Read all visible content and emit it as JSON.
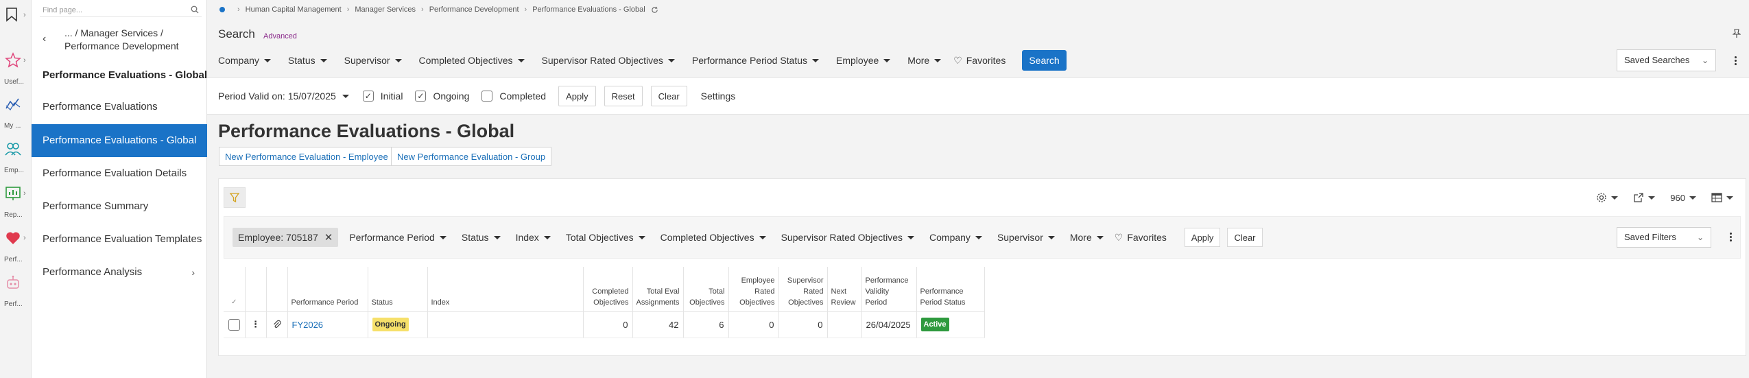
{
  "colors": {
    "accent": "#1a73c7",
    "nav_active_bg": "#1a73c7",
    "badge_ongoing": "#f6e06a",
    "badge_active": "#2e9a3e",
    "advanced_link": "#8a2a8a"
  },
  "rail": {
    "items": [
      {
        "icon": "bookmark-icon",
        "label": ""
      },
      {
        "icon": "star-icon",
        "label": "Usef..."
      },
      {
        "icon": "line-chart-icon",
        "label": "My ..."
      },
      {
        "icon": "people-icon",
        "label": "Emp..."
      },
      {
        "icon": "report-icon",
        "label": "Rep..."
      },
      {
        "icon": "heart-icon",
        "label": "Perf..."
      },
      {
        "icon": "robot-icon",
        "label": "Perf..."
      }
    ]
  },
  "nav": {
    "find_placeholder": "Find page...",
    "breadcrumb": "... / Manager Services / Performance Development",
    "current": "Performance Evaluations - Global",
    "items": [
      {
        "label": "Performance Evaluations"
      },
      {
        "label": "Performance Evaluations - Global"
      },
      {
        "label": "Performance Evaluation Details"
      },
      {
        "label": "Performance Summary"
      },
      {
        "label": "Performance Evaluation Templates"
      },
      {
        "label": "Performance Analysis"
      }
    ]
  },
  "breadcrumbs": [
    "Human Capital Management",
    "Manager Services",
    "Performance Development",
    "Performance Evaluations - Global"
  ],
  "search": {
    "title": "Search",
    "advanced_label": "Advanced",
    "filters": [
      "Company",
      "Status",
      "Supervisor",
      "Completed Objectives",
      "Supervisor Rated Objectives",
      "Performance Period Status",
      "Employee",
      "More"
    ],
    "favorites_label": "Favorites",
    "search_button": "Search",
    "saved_searches_label": "Saved Searches"
  },
  "period": {
    "valid_on": "Period Valid on: 15/07/2025",
    "checkboxes": [
      {
        "label": "Initial",
        "checked": true
      },
      {
        "label": "Ongoing",
        "checked": true
      },
      {
        "label": "Completed",
        "checked": false
      }
    ],
    "apply_label": "Apply",
    "reset_label": "Reset",
    "clear_label": "Clear",
    "settings_label": "Settings"
  },
  "page": {
    "title": "Performance Evaluations - Global",
    "new_employee_button": "New Performance Evaluation - Employee",
    "new_group_button": "New Performance Evaluation - Group"
  },
  "results": {
    "toolbar": {
      "page_size": "960"
    },
    "filter_chip": "Employee: 705187",
    "filters": [
      "Performance Period",
      "Status",
      "Index",
      "Total Objectives",
      "Completed Objectives",
      "Supervisor Rated Objectives",
      "Company",
      "Supervisor",
      "More"
    ],
    "favorites_label": "Favorites",
    "apply_label": "Apply",
    "clear_label": "Clear",
    "saved_filters_label": "Saved Filters",
    "columns": {
      "performance_period": "Performance Period",
      "status": "Status",
      "index": "Index",
      "completed_objectives": "Completed Objectives",
      "total_eval_assignments": "Total Eval Assignments",
      "total_objectives": "Total Objectives",
      "employee_rated_objectives": "Employee Rated Objectives",
      "supervisor_rated_objectives": "Supervisor Rated Objectives",
      "next_review": "Next Review",
      "performance_validity_period": "Performance Validity Period",
      "performance_period_status": "Performance Period Status"
    },
    "rows": [
      {
        "performance_period": "FY2026",
        "status": "Ongoing",
        "index": "",
        "completed_objectives": "0",
        "total_eval_assignments": "42",
        "total_objectives": "6",
        "employee_rated_objectives": "0",
        "supervisor_rated_objectives": "0",
        "next_review": "",
        "performance_validity_period": "26/04/2025",
        "performance_period_status": "Active"
      }
    ]
  }
}
